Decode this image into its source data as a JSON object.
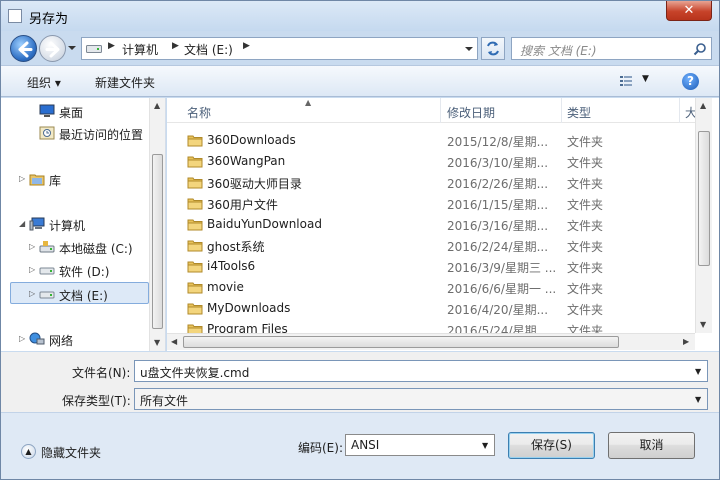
{
  "window": {
    "title": "另存为",
    "close_label": "✕"
  },
  "nav": {
    "breadcrumb": [
      "计算机",
      "文档 (E:)"
    ],
    "search_placeholder": "搜索 文档 (E:)"
  },
  "toolbar": {
    "organize_label": "组织 ▾",
    "new_folder_label": "新建文件夹",
    "help_label": "?"
  },
  "sidebar": {
    "items": [
      {
        "label": "桌面",
        "icon": "desktop-icon"
      },
      {
        "label": "最近访问的位置",
        "icon": "recent-places-icon"
      },
      {
        "label": "库",
        "icon": "library-icon"
      },
      {
        "label": "计算机",
        "icon": "computer-icon"
      },
      {
        "label": "本地磁盘 (C:)",
        "icon": "drive-icon"
      },
      {
        "label": "软件 (D:)",
        "icon": "drive-icon"
      },
      {
        "label": "文档 (E:)",
        "icon": "drive-icon",
        "selected": true
      },
      {
        "label": "网络",
        "icon": "network-icon"
      }
    ]
  },
  "filelist": {
    "columns": {
      "name": "名称",
      "date": "修改日期",
      "type": "类型",
      "size": "大"
    },
    "rows": [
      {
        "name": "360Downloads",
        "date": "2015/12/8/星期...",
        "type": "文件夹"
      },
      {
        "name": "360WangPan",
        "date": "2016/3/10/星期...",
        "type": "文件夹"
      },
      {
        "name": "360驱动大师目录",
        "date": "2016/2/26/星期...",
        "type": "文件夹"
      },
      {
        "name": "360用户文件",
        "date": "2016/1/15/星期...",
        "type": "文件夹"
      },
      {
        "name": "BaiduYunDownload",
        "date": "2016/3/16/星期...",
        "type": "文件夹"
      },
      {
        "name": "ghost系统",
        "date": "2016/2/24/星期...",
        "type": "文件夹"
      },
      {
        "name": "i4Tools6",
        "date": "2016/3/9/星期三 ...",
        "type": "文件夹"
      },
      {
        "name": "movie",
        "date": "2016/6/6/星期一 ...",
        "type": "文件夹"
      },
      {
        "name": "MyDownloads",
        "date": "2016/4/20/星期...",
        "type": "文件夹"
      },
      {
        "name": "Program Files",
        "date": "2016/5/24/星期...",
        "type": "文件夹"
      }
    ]
  },
  "form": {
    "filename_label": "文件名(N):",
    "filename_value": "u盘文件夹恢复.cmd",
    "filetype_label": "保存类型(T):",
    "filetype_value": "所有文件"
  },
  "footer": {
    "hide_folders_label": "隐藏文件夹",
    "encoding_label": "编码(E):",
    "encoding_value": "ANSI",
    "save_label": "保存(S)",
    "cancel_label": "取消"
  },
  "colors": {
    "accent": "#3c7fb1",
    "selection": "#dde9f7",
    "frame": "#c9dbef"
  }
}
